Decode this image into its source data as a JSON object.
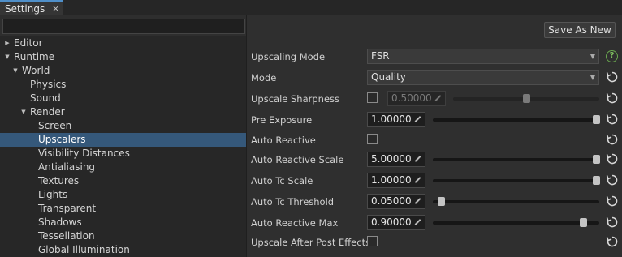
{
  "tab": {
    "label": "Settings",
    "close": "×"
  },
  "search": {
    "placeholder": ""
  },
  "tree": [
    {
      "label": "Editor",
      "depth": 0,
      "arrow": "right",
      "selected": false
    },
    {
      "label": "Runtime",
      "depth": 0,
      "arrow": "down",
      "selected": false
    },
    {
      "label": "World",
      "depth": 1,
      "arrow": "down",
      "selected": false
    },
    {
      "label": "Physics",
      "depth": 2,
      "arrow": "",
      "selected": false
    },
    {
      "label": "Sound",
      "depth": 2,
      "arrow": "",
      "selected": false
    },
    {
      "label": "Render",
      "depth": 2,
      "arrow": "down",
      "selected": false
    },
    {
      "label": "Screen",
      "depth": 3,
      "arrow": "",
      "selected": false
    },
    {
      "label": "Upscalers",
      "depth": 3,
      "arrow": "",
      "selected": true
    },
    {
      "label": "Visibility Distances",
      "depth": 3,
      "arrow": "",
      "selected": false
    },
    {
      "label": "Antialiasing",
      "depth": 3,
      "arrow": "",
      "selected": false
    },
    {
      "label": "Textures",
      "depth": 3,
      "arrow": "",
      "selected": false
    },
    {
      "label": "Lights",
      "depth": 3,
      "arrow": "",
      "selected": false
    },
    {
      "label": "Transparent",
      "depth": 3,
      "arrow": "",
      "selected": false
    },
    {
      "label": "Shadows",
      "depth": 3,
      "arrow": "",
      "selected": false
    },
    {
      "label": "Tessellation",
      "depth": 3,
      "arrow": "",
      "selected": false
    },
    {
      "label": "Global Illumination",
      "depth": 3,
      "arrow": "",
      "selected": false
    }
  ],
  "toolbar": {
    "save_as_new": "Save As New"
  },
  "settings": {
    "upscaling_mode": {
      "label": "Upscaling Mode",
      "value": "FSR"
    },
    "mode": {
      "label": "Mode",
      "value": "Quality"
    },
    "upscale_sharpness": {
      "label": "Upscale Sharpness",
      "checked": false,
      "value": "0.50000",
      "slider": 0.5
    },
    "pre_exposure": {
      "label": "Pre Exposure",
      "value": "1.00000",
      "slider": 1.0
    },
    "auto_reactive": {
      "label": "Auto Reactive",
      "checked": false
    },
    "auto_reactive_scale": {
      "label": "Auto Reactive Scale",
      "value": "5.00000",
      "slider": 1.0
    },
    "auto_tc_scale": {
      "label": "Auto Tc Scale",
      "value": "1.00000",
      "slider": 1.0
    },
    "auto_tc_threshold": {
      "label": "Auto Tc Threshold",
      "value": "0.05000",
      "slider": 0.05
    },
    "auto_reactive_max": {
      "label": "Auto Reactive Max",
      "value": "0.90000",
      "slider": 0.9
    },
    "upscale_after_post_effects": {
      "label": "Upscale After Post Effects",
      "checked": false
    }
  },
  "icons": {
    "help": "?",
    "reset": "reset-icon",
    "edit": "edit-value-icon",
    "accent": "#4f8fc9",
    "selection": "#35587a"
  }
}
